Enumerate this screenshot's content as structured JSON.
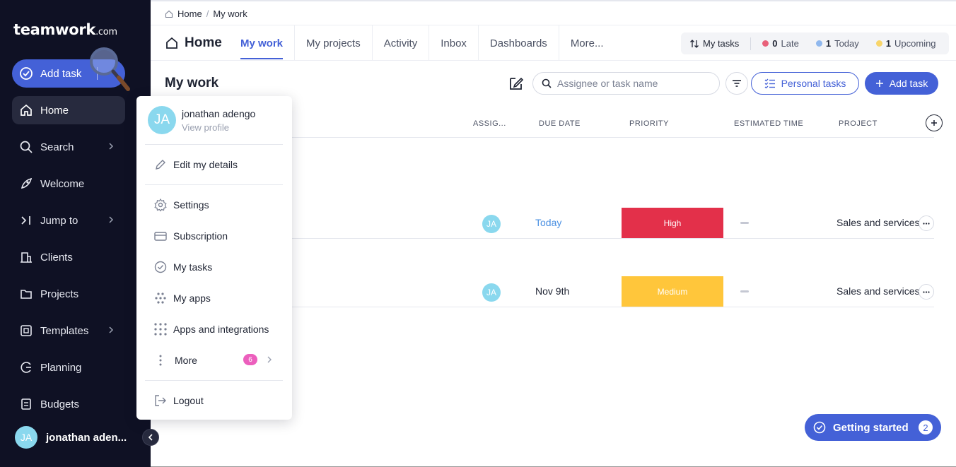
{
  "sidebar": {
    "logo": "teamwork",
    "logo_suffix": ".com",
    "add_task": "Add task",
    "items": [
      {
        "label": "Home",
        "icon": "home-icon"
      },
      {
        "label": "Search",
        "icon": "search-icon"
      },
      {
        "label": "Welcome",
        "icon": "rocket-icon"
      },
      {
        "label": "Jump to",
        "icon": "jump-icon"
      },
      {
        "label": "Clients",
        "icon": "building-icon"
      },
      {
        "label": "Projects",
        "icon": "folder-icon"
      },
      {
        "label": "Templates",
        "icon": "templates-icon"
      },
      {
        "label": "Planning",
        "icon": "planning-icon"
      },
      {
        "label": "Budgets",
        "icon": "budgets-icon"
      }
    ],
    "user": {
      "initials": "JA",
      "name": "jonathan aden..."
    }
  },
  "breadcrumb": {
    "home": "Home",
    "current": "My work"
  },
  "topbar": {
    "title": "Home",
    "tabs": [
      "My work",
      "My projects",
      "Activity",
      "Inbox",
      "Dashboards",
      "More..."
    ],
    "counts": {
      "label": "My tasks",
      "late_num": "0",
      "late_label": "Late",
      "today_num": "1",
      "today_label": "Today",
      "upcoming_num": "1",
      "upcoming_label": "Upcoming"
    }
  },
  "main": {
    "title": "My work",
    "search_placeholder": "Assignee or task name",
    "personal_tasks": "Personal tasks",
    "add_task": "Add task",
    "columns": [
      "ASSIG...",
      "DUE DATE",
      "PRIORITY",
      "ESTIMATED TIME",
      "PROJECT"
    ],
    "rows": [
      {
        "assignee": "JA",
        "due": "Today",
        "priority": "High",
        "estimated": "",
        "project": "Sales and services"
      },
      {
        "assignee": "JA",
        "due": "Nov 9th",
        "priority": "Medium",
        "estimated": "",
        "project": "Sales and services"
      }
    ],
    "getting_started": "Getting started",
    "getting_started_count": "2"
  },
  "profile_menu": {
    "initials": "JA",
    "name": "jonathan adengo",
    "view_profile": "View profile",
    "edit": "Edit my details",
    "items": [
      "Settings",
      "Subscription",
      "My tasks",
      "My apps",
      "Apps and integrations"
    ],
    "more": "More",
    "more_badge": "6",
    "logout": "Logout"
  },
  "colors": {
    "accent": "#4461d7",
    "sidebar_bg": "#0f1124",
    "priority_high": "#e3304a",
    "priority_medium": "#ffc63b",
    "late_dot": "#e8617a",
    "today_dot": "#90b8ee",
    "upcoming_dot": "#f8d56a",
    "due_today": "#4a90e2"
  }
}
